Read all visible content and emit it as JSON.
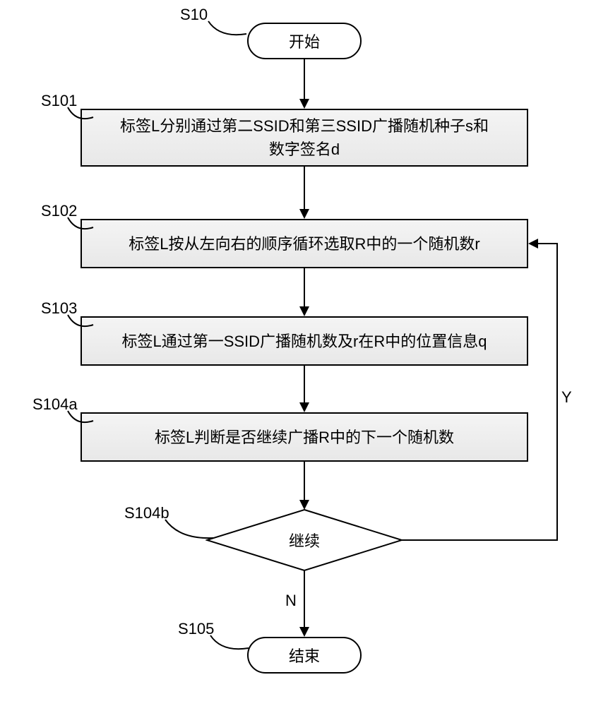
{
  "nodes": {
    "start": "开始",
    "s101": "标签L分别通过第二SSID和第三SSID广播随机种子s和\n数字签名d",
    "s102": "标签L按从左向右的顺序循环选取R中的一个随机数r",
    "s103": "标签L通过第一SSID广播随机数及r在R中的位置信息q",
    "s104a": "标签L判断是否继续广播R中的下一个随机数",
    "s104b": "继续",
    "end": "结束"
  },
  "labels": {
    "s10": "S10",
    "s101": "S101",
    "s102": "S102",
    "s103": "S103",
    "s104a": "S104a",
    "s104b": "S104b",
    "s105": "S105"
  },
  "yn": {
    "y": "Y",
    "n": "N"
  },
  "chart_data": {
    "type": "flowchart",
    "start": "S10",
    "end": "S105",
    "nodes": [
      {
        "id": "S10",
        "shape": "terminator",
        "text": "开始"
      },
      {
        "id": "S101",
        "shape": "process",
        "text": "标签L分别通过第二SSID和第三SSID广播随机种子s和数字签名d"
      },
      {
        "id": "S102",
        "shape": "process",
        "text": "标签L按从左向右的顺序循环选取R中的一个随机数r"
      },
      {
        "id": "S103",
        "shape": "process",
        "text": "标签L通过第一SSID广播随机数及r在R中的位置信息q"
      },
      {
        "id": "S104a",
        "shape": "process",
        "text": "标签L判断是否继续广播R中的下一个随机数"
      },
      {
        "id": "S104b",
        "shape": "decision",
        "text": "继续"
      },
      {
        "id": "S105",
        "shape": "terminator",
        "text": "结束"
      }
    ],
    "edges": [
      {
        "from": "S10",
        "to": "S101"
      },
      {
        "from": "S101",
        "to": "S102"
      },
      {
        "from": "S102",
        "to": "S103"
      },
      {
        "from": "S103",
        "to": "S104a"
      },
      {
        "from": "S104a",
        "to": "S104b"
      },
      {
        "from": "S104b",
        "to": "S102",
        "label": "Y"
      },
      {
        "from": "S104b",
        "to": "S105",
        "label": "N"
      }
    ]
  }
}
